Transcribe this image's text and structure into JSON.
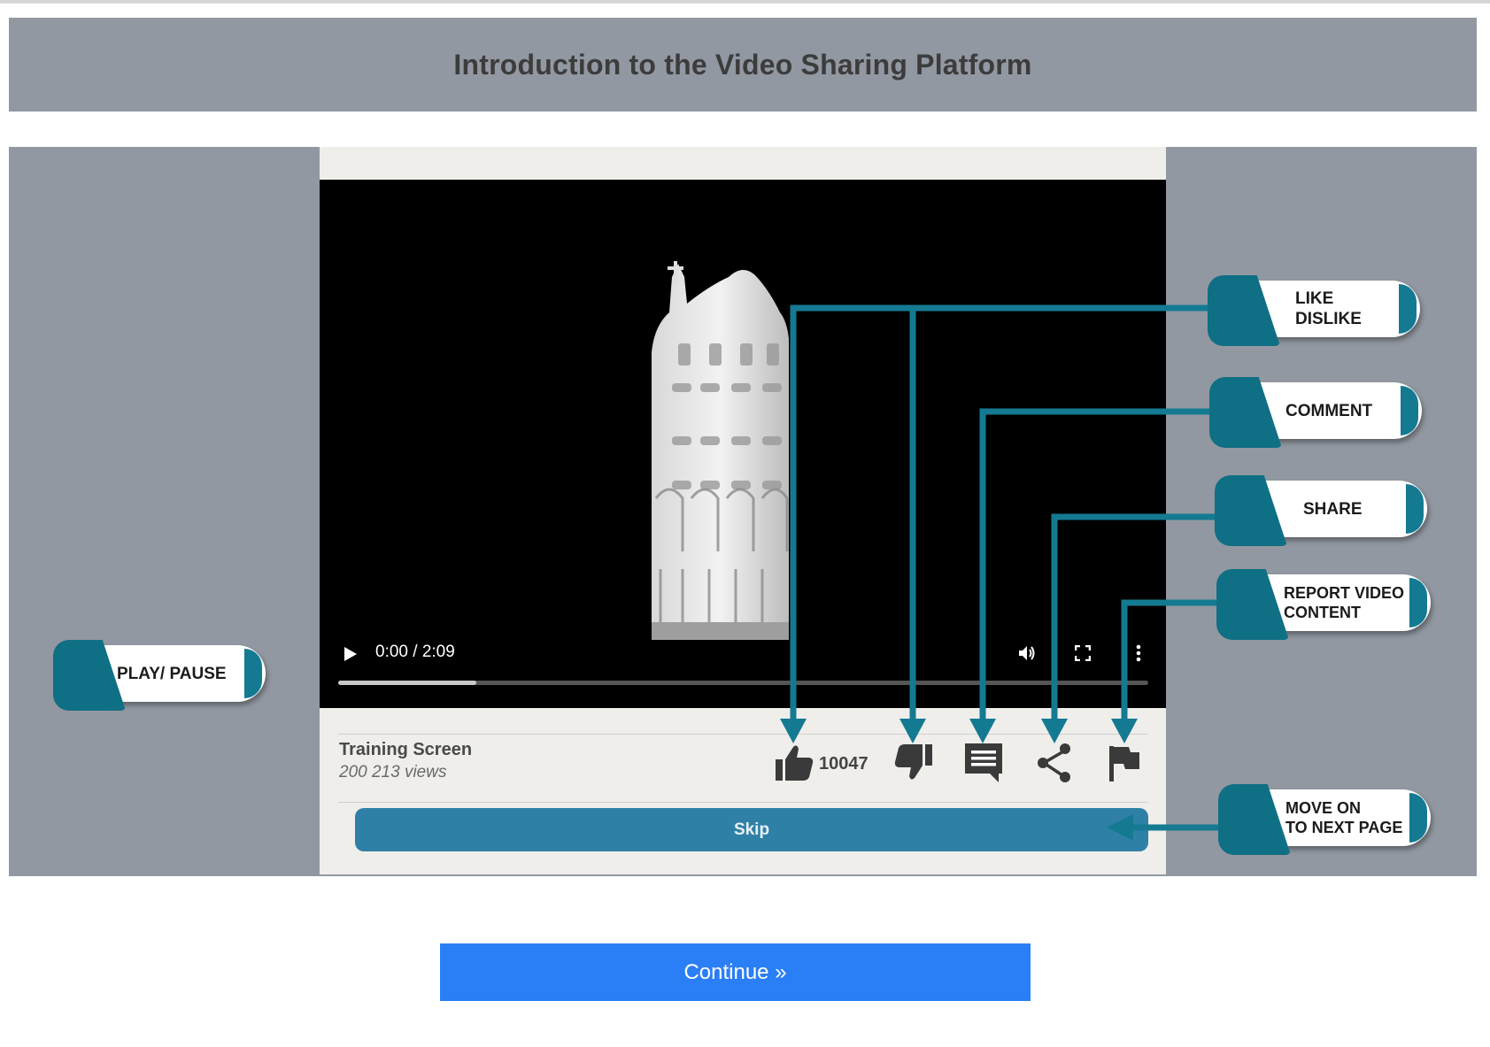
{
  "header": {
    "title": "Introduction to the Video Sharing Platform"
  },
  "player": {
    "time": "0:00 / 2:09",
    "progress": 0.17,
    "video_title": "Training Screen",
    "views": "200 213 views",
    "like_count": "10047",
    "skip_label": "Skip"
  },
  "callouts": {
    "like_line1": "LIKE",
    "like_line2": "DISLIKE",
    "comment": "COMMENT",
    "share": "SHARE",
    "report_line1": "REPORT VIDEO",
    "report_line2": "CONTENT",
    "play_pause": "PLAY/ PAUSE",
    "next_line1": "MOVE ON",
    "next_line2": "TO NEXT PAGE"
  },
  "continue_label": "Continue »",
  "colors": {
    "accent_teal": "#147a92",
    "skip_blue": "#2f80a7",
    "continue_blue": "#2a7ef6",
    "stage_gray": "#9298a1"
  },
  "icons": [
    "play-icon",
    "volume-icon",
    "fullscreen-icon",
    "more-icon",
    "thumbs-up-icon",
    "thumbs-down-icon",
    "comment-icon",
    "share-icon",
    "flag-icon"
  ]
}
